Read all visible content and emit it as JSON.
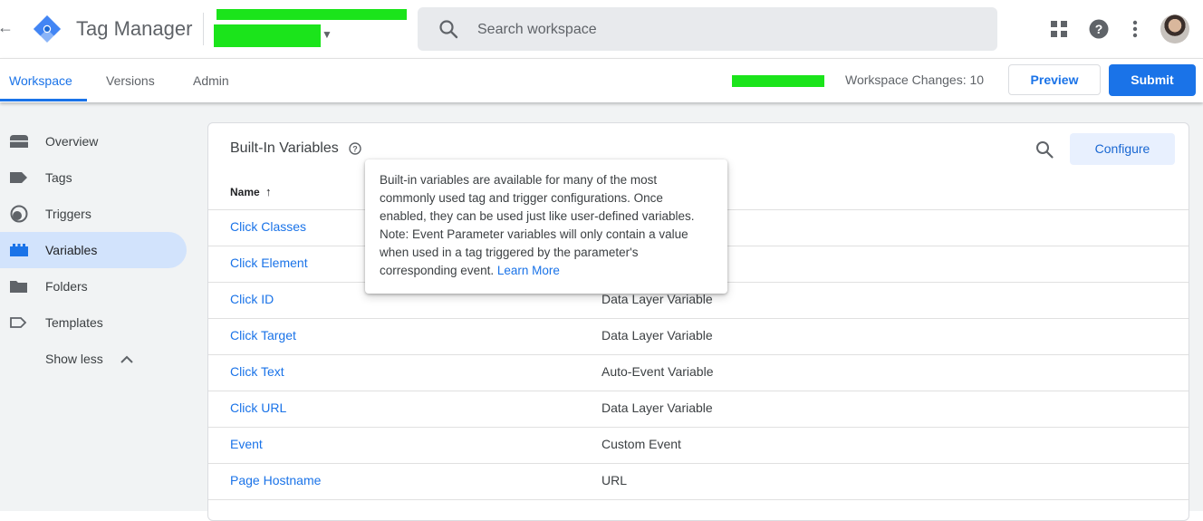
{
  "app": {
    "name": "Tag Manager"
  },
  "search": {
    "placeholder": "Search workspace"
  },
  "tabs": [
    {
      "label": "Workspace",
      "active": true
    },
    {
      "label": "Versions",
      "active": false
    },
    {
      "label": "Admin",
      "active": false
    }
  ],
  "header": {
    "workspace_changes": "Workspace Changes: 10",
    "preview_label": "Preview",
    "submit_label": "Submit"
  },
  "sidebar": {
    "items": [
      {
        "label": "Overview",
        "icon": "overview-icon"
      },
      {
        "label": "Tags",
        "icon": "tag-icon"
      },
      {
        "label": "Triggers",
        "icon": "trigger-icon"
      },
      {
        "label": "Variables",
        "icon": "variables-icon",
        "active": true
      },
      {
        "label": "Folders",
        "icon": "folder-icon"
      },
      {
        "label": "Templates",
        "icon": "template-icon"
      }
    ],
    "show_less_label": "Show less"
  },
  "card": {
    "title": "Built-In Variables",
    "configure_label": "Configure",
    "name_header": "Name",
    "rows": [
      {
        "name": "Click Classes",
        "type": ""
      },
      {
        "name": "Click Element",
        "type": ""
      },
      {
        "name": "Click ID",
        "type": "Data Layer Variable"
      },
      {
        "name": "Click Target",
        "type": "Data Layer Variable"
      },
      {
        "name": "Click Text",
        "type": "Auto-Event Variable"
      },
      {
        "name": "Click URL",
        "type": "Data Layer Variable"
      },
      {
        "name": "Event",
        "type": "Custom Event"
      },
      {
        "name": "Page Hostname",
        "type": "URL"
      }
    ]
  },
  "tooltip": {
    "text": "Built-in variables are available for many of the most commonly used tag and trigger configurations. Once enabled, they can be used just like user-defined variables. Note: Event Parameter variables will only contain a value when used in a tag triggered by the parameter's corresponding event.",
    "link_label": "Learn More"
  },
  "colors": {
    "accent": "#1a73e8",
    "redaction": "#1be41b",
    "sidebar_active_bg": "#d2e3fc"
  }
}
